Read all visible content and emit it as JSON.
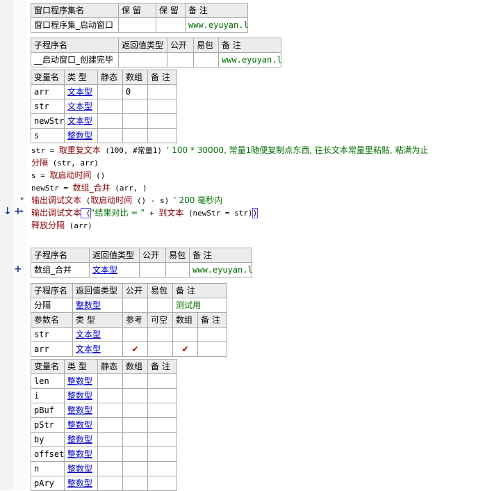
{
  "window_table": {
    "headers": [
      "窗口程序集名",
      "保 留",
      "保 留",
      "备 注"
    ],
    "row": [
      "窗口程序集_启动窗口",
      "",
      "",
      "www.eyuyan.la"
    ]
  },
  "sub1": {
    "headers": [
      "子程序名",
      "返回值类型",
      "公开",
      "易包",
      "备 注"
    ],
    "row": [
      "__启动窗口_创建完毕",
      "",
      "",
      "",
      "www.eyuyan.la"
    ]
  },
  "vars1": {
    "headers": [
      "变量名",
      "类 型",
      "静态",
      "数组",
      "备 注"
    ],
    "rows": [
      [
        "arr",
        "文本型",
        "",
        "0",
        ""
      ],
      [
        "str",
        "文本型",
        "",
        "",
        ""
      ],
      [
        "newStr",
        "文本型",
        "",
        "",
        ""
      ],
      [
        "s",
        "整数型",
        "",
        "",
        ""
      ]
    ]
  },
  "code": {
    "l1_a": "str = ",
    "l1_b": "取重复文本",
    "l1_c": " (100, #常量1) ",
    "l1_d": "’ 100 * 30000, 常量1随便复制点东西, 往长文本常量里粘贴, 粘满为止",
    "l2_a": "分隔",
    "l2_b": " (str, arr)",
    "l3_a": "s = ",
    "l3_b": "取启动时间",
    "l3_c": " ()",
    "l4_a": "newStr = ",
    "l4_b": "数组_合并",
    "l4_c": " (arr, )",
    "l5_a": "输出调试文本",
    "l5_b": " (",
    "l5_c": "取启动时间",
    "l5_d": " () - s) ",
    "l5_e": "’ 200 毫秒内",
    "l6_a": "输出调试文本",
    "l6_b": " (",
    "l6_c": "“结果对比 = ”",
    "l6_d": " + ",
    "l6_e": "到文本",
    "l6_f": " (newStr = str)",
    "l6_g": ")",
    "l7_a": "释放分隔",
    "l7_b": " (arr)"
  },
  "sub2": {
    "headers": [
      "子程序名",
      "返回值类型",
      "公开",
      "易包",
      "备 注"
    ],
    "row": [
      "数组_合并",
      "文本型",
      "",
      "",
      "www.eyuyan.la"
    ]
  },
  "sub3": {
    "headers": [
      "子程序名",
      "返回值类型",
      "公开",
      "易包",
      "备 注"
    ],
    "row": [
      "分隔",
      "整数型",
      "",
      "",
      "测试用"
    ]
  },
  "params3": {
    "headers": [
      "参数名",
      "类 型",
      "参考",
      "可空",
      "数组",
      "备 注"
    ],
    "rows": [
      [
        "str",
        "文本型",
        "",
        "",
        "",
        ""
      ],
      [
        "arr",
        "文本型",
        "✔",
        "",
        "✔",
        ""
      ]
    ]
  },
  "vars3": {
    "headers": [
      "变量名",
      "类 型",
      "静态",
      "数组",
      "备 注"
    ],
    "rows": [
      [
        "len",
        "整数型"
      ],
      [
        "i",
        "整数型"
      ],
      [
        "pBuf",
        "整数型"
      ],
      [
        "pStr",
        "整数型"
      ],
      [
        "by",
        "整数型"
      ],
      [
        "offset",
        "整数型"
      ],
      [
        "n",
        "整数型"
      ],
      [
        "pAry",
        "整数型"
      ]
    ]
  },
  "markers": {
    "arrow_down": "↓",
    "plus": "+",
    "fold": "▸"
  },
  "colors": {
    "keyword": "#8b0000",
    "comment": "#007000",
    "type_link": "#0000c8",
    "header_bg": "#ececec",
    "border": "#a8a8a8"
  }
}
